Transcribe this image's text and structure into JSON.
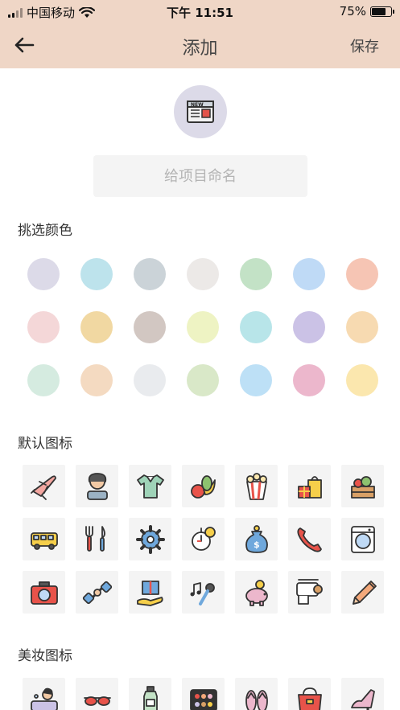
{
  "status_bar": {
    "carrier": "中国移动",
    "time": "下午 11:51",
    "battery": "75%"
  },
  "nav": {
    "title": "添加",
    "save_label": "保存",
    "back_icon": "arrow-left-icon"
  },
  "project": {
    "icon": "newspaper-icon",
    "name_placeholder": "给项目命名",
    "name_value": ""
  },
  "colors_section": {
    "title": "挑选颜色",
    "swatches": [
      "#dcdae8",
      "#bde3ec",
      "#cbd3d8",
      "#ece9e7",
      "#c3e2c6",
      "#bfdaf6",
      "#f6c5b4",
      "#f4d7d8",
      "#f1d8a2",
      "#d2c7c2",
      "#eef3c3",
      "#b8e5e9",
      "#cbc2e6",
      "#f7dab1",
      "#d5ebe0",
      "#f4dac1",
      "#e9ebee",
      "#d9e8c8",
      "#bde0f6",
      "#ecb7cc",
      "#fbe7ae"
    ]
  },
  "default_icons_section": {
    "title": "默认图标",
    "icons": [
      "airplane-icon",
      "person-portrait-icon",
      "polo-shirt-icon",
      "fruit-icon",
      "popcorn-icon",
      "gift-shopping-icon",
      "vegetable-crate-icon",
      "bus-icon",
      "cutlery-icon",
      "gear-icon",
      "stopwatch-coin-icon",
      "money-bag-icon",
      "phone-icon",
      "washing-machine-icon",
      "camera-icon",
      "dumbbell-icon",
      "gift-hand-icon",
      "music-microphone-icon",
      "piggy-bank-icon",
      "toilet-paper-icon",
      "pencil-icon"
    ]
  },
  "makeup_icons_section": {
    "title": "美妆图标",
    "icons": [
      "bath-person-icon",
      "sunglasses-icon",
      "lotion-bottle-icon",
      "eyeshadow-palette-icon",
      "flip-flops-icon",
      "handbag-icon",
      "high-heel-icon"
    ]
  }
}
